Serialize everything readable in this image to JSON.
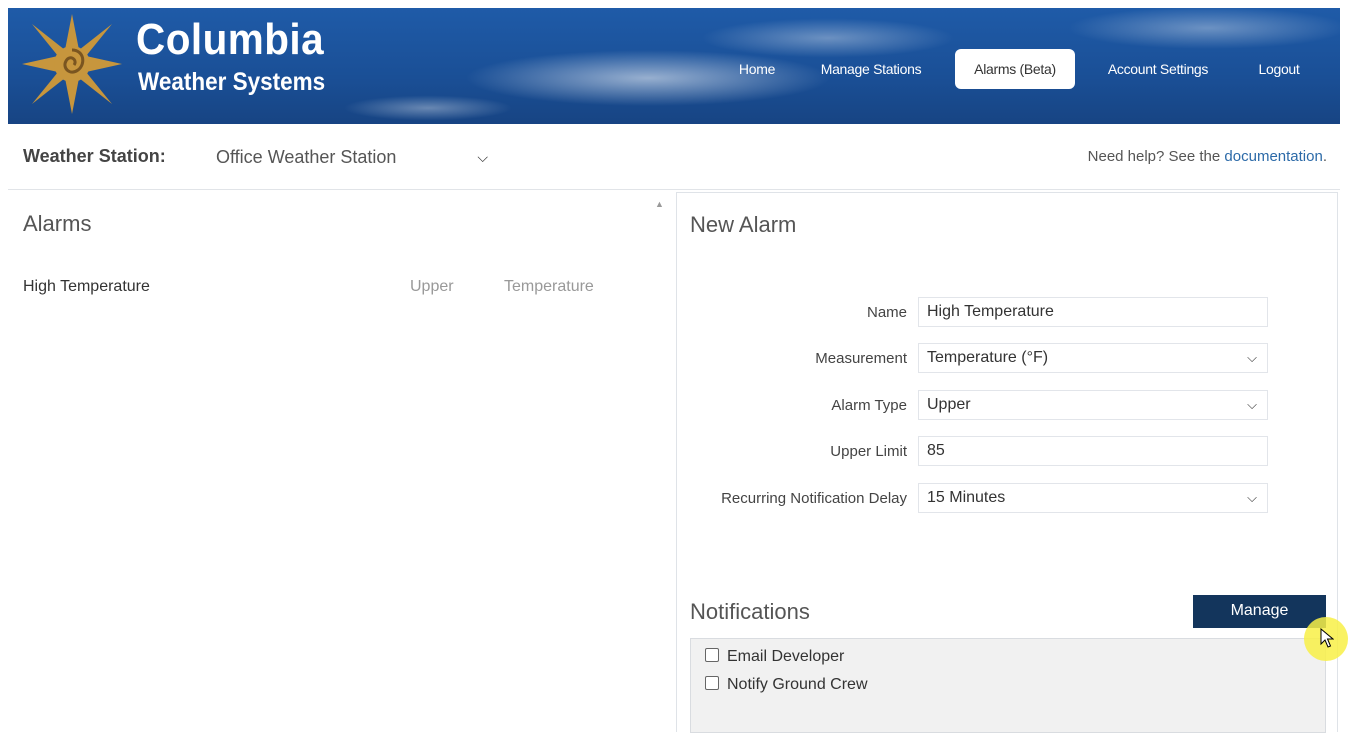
{
  "header": {
    "brand_name": "Columbia",
    "brand_sub": "Weather Systems",
    "colors": {
      "banner": "#1a4f96",
      "logo_star": "#c7963d"
    },
    "nav": [
      {
        "label": "Home",
        "active": false
      },
      {
        "label": "Manage Stations",
        "active": false
      },
      {
        "label": "Alarms (Beta)",
        "active": true
      },
      {
        "label": "Account Settings",
        "active": false
      },
      {
        "label": "Logout",
        "active": false
      }
    ]
  },
  "station_bar": {
    "label": "Weather Station:",
    "selected": "Office Weather Station",
    "help_prefix": "Need help? See the ",
    "help_link": "documentation",
    "help_suffix": "."
  },
  "alarms": {
    "title": "Alarms",
    "items": [
      {
        "name": "High Temperature",
        "type": "Upper",
        "measurement": "Temperature"
      }
    ]
  },
  "new_alarm": {
    "title": "New Alarm",
    "fields": {
      "name": {
        "label": "Name",
        "value": "High Temperature"
      },
      "measurement": {
        "label": "Measurement",
        "value": "Temperature (°F)"
      },
      "alarm_type": {
        "label": "Alarm Type",
        "value": "Upper"
      },
      "upper_limit": {
        "label": "Upper Limit",
        "value": "85"
      },
      "delay": {
        "label": "Recurring Notification Delay",
        "value": "15 Minutes"
      }
    }
  },
  "notifications": {
    "title": "Notifications",
    "manage_label": "Manage",
    "manage_color": "#13355c",
    "items": [
      {
        "label": "Email Developer",
        "checked": false
      },
      {
        "label": "Notify Ground Crew",
        "checked": false
      }
    ]
  },
  "icons": {
    "logo": "sun-star-logo-icon",
    "chevron": "chevron-down-icon",
    "cursor": "mouse-pointer-icon"
  }
}
